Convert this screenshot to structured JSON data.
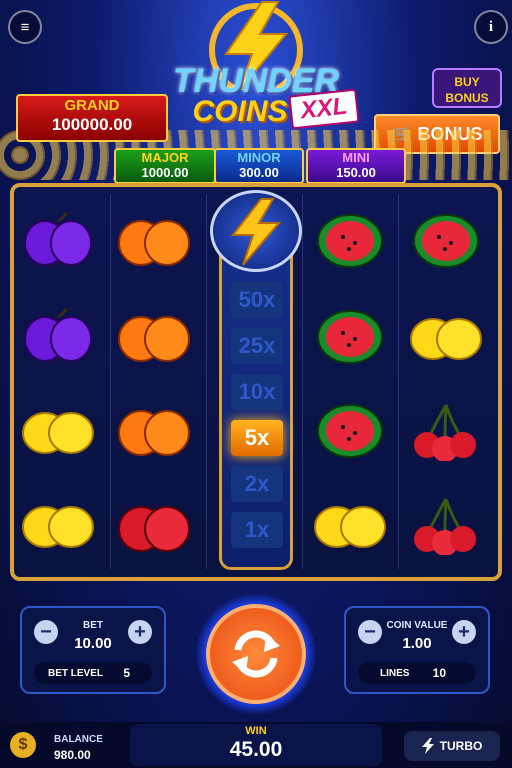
{
  "title": {
    "line1": "THUNDER",
    "line2": "COINS",
    "badge": "XXL"
  },
  "jackpots": {
    "grand": {
      "label": "GRAND",
      "value": "100000.00"
    },
    "major": {
      "label": "MAJOR",
      "value": "1000.00"
    },
    "minor": {
      "label": "MINOR",
      "value": "300.00"
    },
    "mini": {
      "label": "MINI",
      "value": "150.00"
    }
  },
  "buttons": {
    "buy_bonus_line1": "BUY",
    "buy_bonus_line2": "BONUS",
    "bonus": "BONUS",
    "turbo": "TURBO",
    "menu_icon": "≡",
    "info_icon": "i"
  },
  "reels": [
    [
      "plum",
      "plum",
      "lemon",
      "lemon"
    ],
    [
      "orange",
      "orange",
      "orange",
      "cherry-red"
    ],
    [
      "thunder",
      "",
      "",
      ""
    ],
    [
      "watermelon",
      "watermelon",
      "watermelon",
      "lemon"
    ],
    [
      "watermelon",
      "lemon",
      "cherries",
      "cherries"
    ]
  ],
  "multipliers": [
    "50x",
    "25x",
    "10x",
    "5x",
    "2x",
    "1x"
  ],
  "active_multiplier": "5x",
  "bet_panel": {
    "title": "BET",
    "value": "10.00",
    "level_label": "BET LEVEL",
    "level_value": "5",
    "minus": "−",
    "plus": "+"
  },
  "coin_panel": {
    "title": "COIN VALUE",
    "value": "1.00",
    "lines_label": "LINES",
    "lines_value": "10",
    "minus": "−",
    "plus": "+"
  },
  "balance": {
    "label": "BALANCE",
    "value": "980.00",
    "icon": "$"
  },
  "win": {
    "label": "WIN",
    "value": "45.00"
  },
  "colors": {
    "accent": "#d8a13a",
    "spin": "#f25a1a"
  }
}
